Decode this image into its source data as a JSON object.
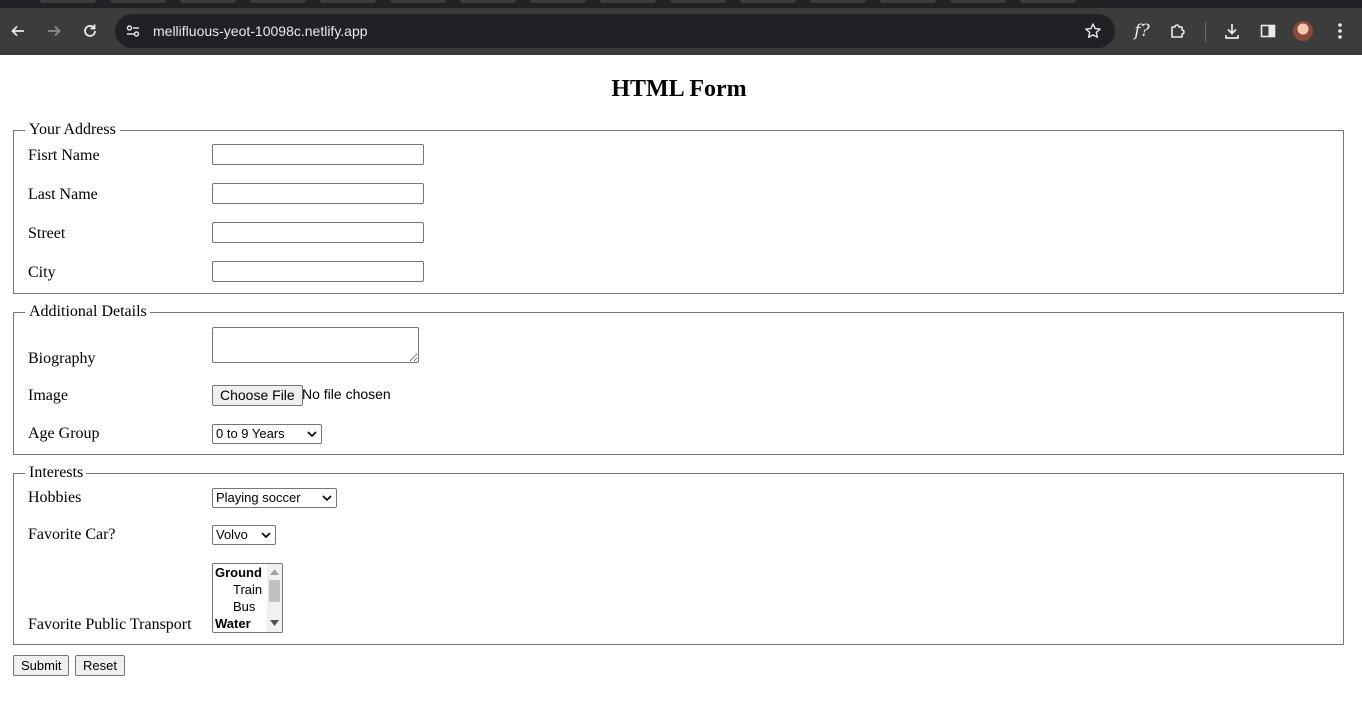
{
  "browser": {
    "url": "mellifluous-yeot-10098c.netlify.app",
    "extension_label": "f?"
  },
  "page": {
    "title": "HTML Form"
  },
  "address": {
    "legend": "Your Address",
    "first_name_label": "Fisrt Name",
    "last_name_label": "Last Name",
    "street_label": "Street",
    "city_label": "City"
  },
  "details": {
    "legend": "Additional Details",
    "biography_label": "Biography",
    "image_label": "Image",
    "choose_file_label": "Choose File",
    "file_status": "No file chosen",
    "age_group_label": "Age Group",
    "age_group_value": "0 to 9 Years"
  },
  "interests": {
    "legend": "Interests",
    "hobbies_label": "Hobbies",
    "hobbies_value": "Playing soccer",
    "car_label": "Favorite Car?",
    "car_value": "Volvo",
    "transport_label": "Favorite Public Transport",
    "transport_items": [
      {
        "text": "Ground",
        "group": true
      },
      {
        "text": "Train",
        "group": false
      },
      {
        "text": "Bus",
        "group": false
      },
      {
        "text": "Water",
        "group": true
      }
    ]
  },
  "actions": {
    "submit_label": "Submit",
    "reset_label": "Reset"
  }
}
